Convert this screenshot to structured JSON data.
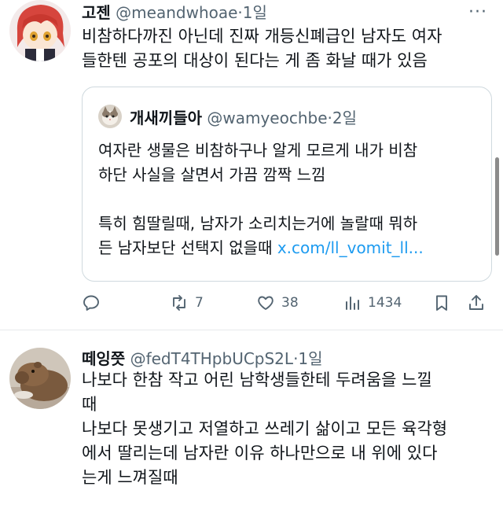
{
  "tweet1": {
    "name": "고젠",
    "handle": "@meandwhoae",
    "time": "1일",
    "lines": [
      "비참하다까진 아닌데 진짜 개등신폐급인 남자도 여자",
      "들한텐 공포의 대상이 된다는 게 좀 화날 때가 있음"
    ],
    "quote": {
      "name": "개새끼들아",
      "handle": "@wamyeochbe",
      "time": "2일",
      "lines": [
        "여자란 생물은 비참하구나 알게 모르게 내가 비참",
        "하단 사실을 살면서 가끔 깜짝 느낌",
        "",
        "특히 힘딸릴때, 남자가 소리치는거에 놀랄때 뭐하",
        "든 남자보단 선택지 없을때 "
      ],
      "link": "x.com/ll_vomit_ll..."
    },
    "actions": {
      "retweets": "7",
      "likes": "38",
      "views": "1434"
    }
  },
  "tweet2": {
    "name": "떼잉쯧",
    "handle": "@fedT4THpbUCpS2L",
    "time": "1일",
    "lines": [
      "나보다 한참 작고 어린 남학생들한테 두려움을 느낄",
      "때",
      "나보다 못생기고 저열하고 쓰레기 삶이고 모든 육각형",
      "에서 딸리는데 남자란 이유 하나만으로 내 위에 있다",
      "는게 느껴질때"
    ]
  },
  "separator": "·",
  "more_glyph": "···",
  "colors": {
    "text": "#0f1419",
    "muted": "#536471",
    "link": "#1d9bf0",
    "border": "#cfd9de"
  }
}
